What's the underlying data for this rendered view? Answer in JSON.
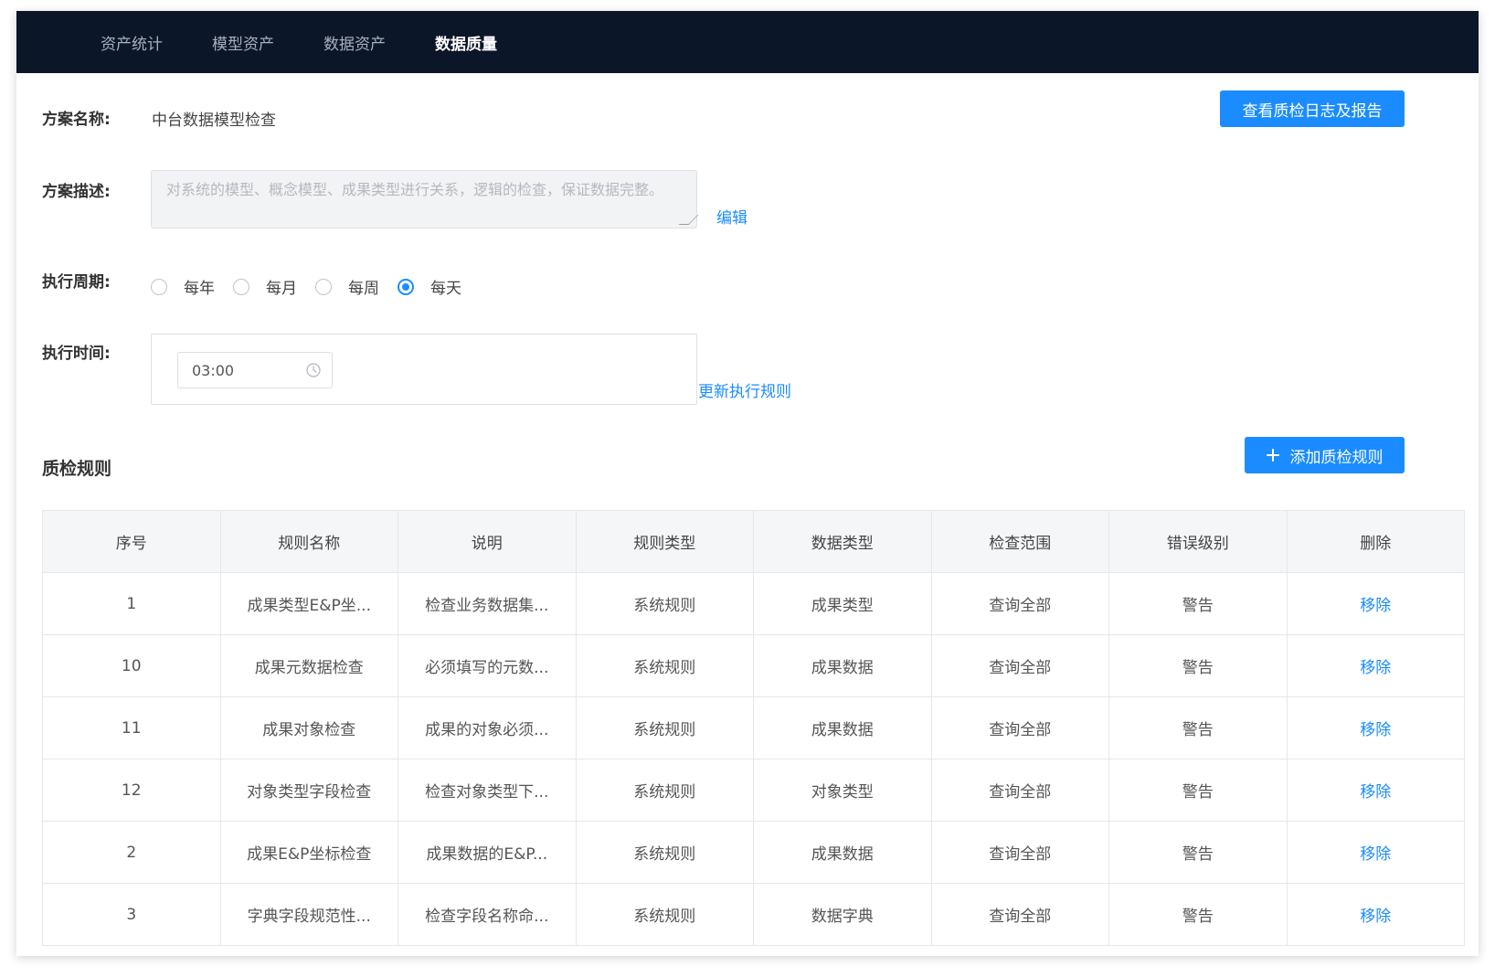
{
  "nav": {
    "tabs": [
      {
        "label": "资产统计",
        "active": false
      },
      {
        "label": "模型资产",
        "active": false
      },
      {
        "label": "数据资产",
        "active": false
      },
      {
        "label": "数据质量",
        "active": true
      }
    ]
  },
  "form": {
    "plan_name_label": "方案名称:",
    "plan_name_value": "中台数据模型检查",
    "view_log_button": "查看质检日志及报告",
    "desc_label": "方案描述:",
    "desc_value": "对系统的模型、概念模型、成果类型进行关系，逻辑的检查，保证数据完整。",
    "edit_link": "编辑",
    "period_label": "执行周期:",
    "period_options": [
      "每年",
      "每月",
      "每周",
      "每天"
    ],
    "period_selected": "每天",
    "time_label": "执行时间:",
    "time_value": "03:00",
    "update_rule_link": "更新执行规则"
  },
  "rules": {
    "title": "质检规则",
    "add_button": "添加质检规则",
    "columns": [
      "序号",
      "规则名称",
      "说明",
      "规则类型",
      "数据类型",
      "检查范围",
      "错误级别",
      "删除"
    ],
    "rows": [
      [
        "1",
        "成果类型E&P坐...",
        "检查业务数据集...",
        "系统规则",
        "成果类型",
        "查询全部",
        "警告",
        "移除"
      ],
      [
        "10",
        "成果元数据检查",
        "必须填写的元数...",
        "系统规则",
        "成果数据",
        "查询全部",
        "警告",
        "移除"
      ],
      [
        "11",
        "成果对象检查",
        "成果的对象必须...",
        "系统规则",
        "成果数据",
        "查询全部",
        "警告",
        "移除"
      ],
      [
        "12",
        "对象类型字段检查",
        "检查对象类型下...",
        "系统规则",
        "对象类型",
        "查询全部",
        "警告",
        "移除"
      ],
      [
        "2",
        "成果E&P坐标检查",
        "成果数据的E&P...",
        "系统规则",
        "成果数据",
        "查询全部",
        "警告",
        "移除"
      ],
      [
        "3",
        "字典字段规范性...",
        "检查字段名称命...",
        "系统规则",
        "数据字典",
        "查询全部",
        "警告",
        "移除"
      ]
    ]
  },
  "colors": {
    "nav_bg": "#0c1629",
    "primary": "#1a8cff"
  }
}
